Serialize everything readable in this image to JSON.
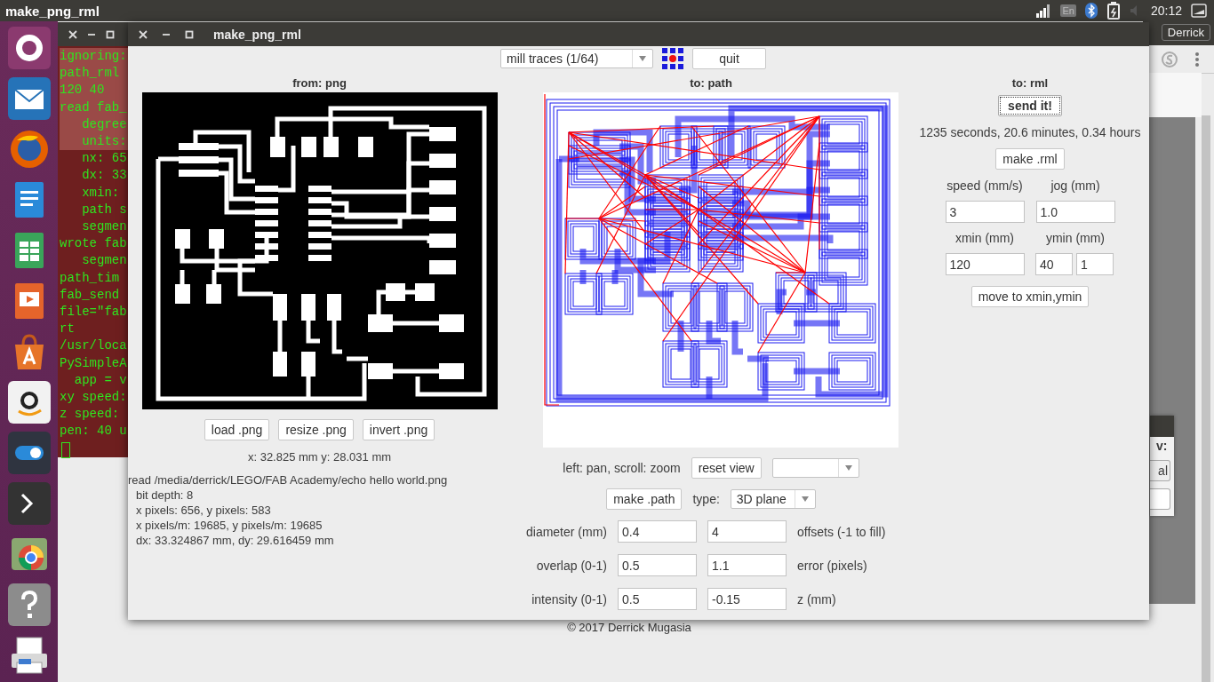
{
  "top_panel": {
    "title": "make_png_rml",
    "keyboard": "En",
    "time": "20:12"
  },
  "launcher": {
    "items": [
      {
        "kind": "ubuntu"
      },
      {
        "kind": "mail"
      },
      {
        "kind": "firefox"
      },
      {
        "kind": "writer"
      },
      {
        "kind": "calc"
      },
      {
        "kind": "impress"
      },
      {
        "kind": "store"
      },
      {
        "kind": "amazon"
      },
      {
        "kind": "toggle"
      },
      {
        "kind": "terminal"
      },
      {
        "kind": "chrome"
      },
      {
        "kind": "help"
      },
      {
        "kind": "printer"
      }
    ]
  },
  "terminal": {
    "lines": [
      {
        "text": "ignoring:",
        "selected": true
      },
      {
        "text": "path_rml",
        "selected": true
      },
      {
        "text": "120 40",
        "selected": true
      },
      {
        "text": "read fab_",
        "selected": true
      },
      {
        "text": "   degree",
        "selected": true
      },
      {
        "text": "   units:",
        "selected": true
      },
      {
        "text": "   nx: 65",
        "selected": false
      },
      {
        "text": "   dx: 33",
        "selected": false
      },
      {
        "text": "   xmin:",
        "selected": false
      },
      {
        "text": "   path s",
        "selected": false
      },
      {
        "text": "   segmen",
        "selected": false
      },
      {
        "text": "wrote fab",
        "selected": false
      },
      {
        "text": "   segmen",
        "selected": false
      },
      {
        "text": "path_tim",
        "selected": false
      },
      {
        "text": "fab_send",
        "selected": false
      },
      {
        "text": "file=\"fab",
        "selected": false
      },
      {
        "text": "rt",
        "selected": false
      },
      {
        "text": "/usr/loca",
        "selected": false
      },
      {
        "text": "PySimpleA",
        "selected": false
      },
      {
        "text": "  app = v",
        "selected": false
      },
      {
        "text": "xy speed:",
        "selected": false
      },
      {
        "text": "z speed:",
        "selected": false
      },
      {
        "text": "pen: 40 u",
        "selected": false
      }
    ]
  },
  "browser": {
    "user_button": "Derrick",
    "footer": "© 2017 Derrick Mugasia",
    "dialog_fragment": {
      "label": "v:",
      "button": "al"
    }
  },
  "window": {
    "title": "make_png_rml",
    "mode_select": "mill traces (1/64)",
    "quit": "quit",
    "png_panel": {
      "heading": "from: png",
      "buttons": [
        "load .png",
        "resize .png",
        "invert .png"
      ],
      "coordinates": "x: 32.825 mm  y: 28.031 mm",
      "info": [
        "read /media/derrick/LEGO/FAB Academy/echo hello world.png",
        "bit depth: 8",
        "x pixels: 656, y pixels: 583",
        "x pixels/m: 19685, y pixels/m: 19685",
        "dx: 33.324867 mm, dy: 29.616459 mm"
      ]
    },
    "path_panel": {
      "heading": "to: path",
      "hint": "left: pan, scroll: zoom",
      "reset": "reset view",
      "make_path": "make .path",
      "type_label": "type:",
      "type_select": "3D plane",
      "params": [
        {
          "label": "diameter (mm)",
          "value": "0.4",
          "value_2": "4",
          "label_2": "offsets (-1 to fill)"
        },
        {
          "label": "overlap (0-1)",
          "value": "0.5",
          "value_2": "1.1",
          "label_2": "error (pixels)"
        },
        {
          "label": "intensity (0-1)",
          "value": "0.5",
          "value_2": "-0.15",
          "label_2": "z (mm)"
        }
      ]
    },
    "rml_panel": {
      "heading": "to: rml",
      "send": "send it!",
      "estimate": "1235 seconds, 20.6 minutes, 0.34 hours",
      "make": "make .rml",
      "fields": [
        {
          "label": "speed (mm/s)",
          "value": "3"
        },
        {
          "label": "jog (mm)",
          "value": "1.0"
        },
        {
          "label": "xmin (mm)",
          "value": "120"
        },
        {
          "label": "ymin (mm)",
          "value": "40",
          "value_2": "1"
        }
      ],
      "move": "move to xmin,ymin"
    }
  }
}
